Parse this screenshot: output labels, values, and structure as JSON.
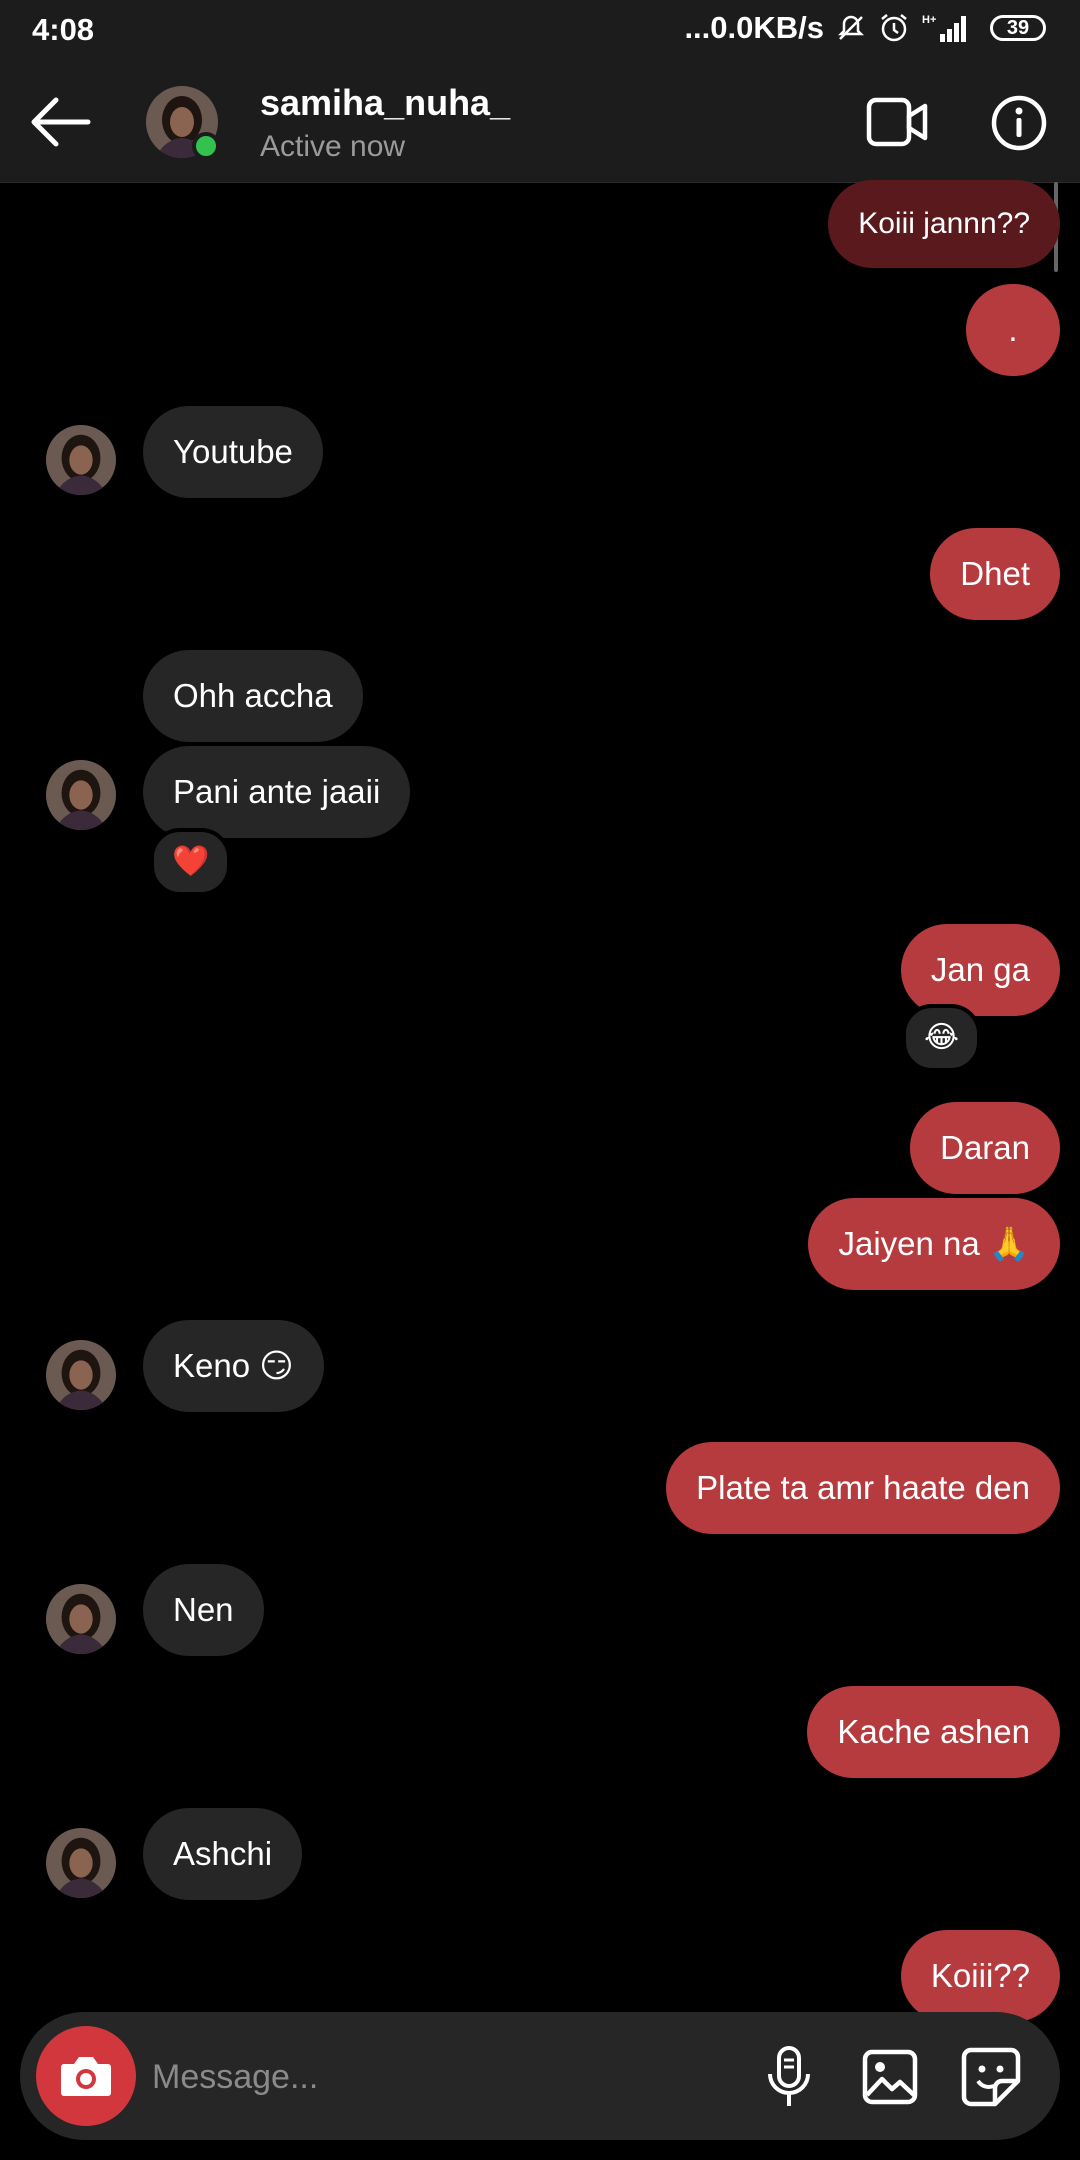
{
  "status_bar": {
    "time": "4:08",
    "network_speed": "...0.0KB/s",
    "battery": "39",
    "signal_label": "H+"
  },
  "header": {
    "username": "samiha_nuha_",
    "status": "Active now",
    "back_icon": "arrow-left-icon",
    "video_icon": "video-camera-icon",
    "info_icon": "info-icon"
  },
  "messages": [
    {
      "side": "out",
      "text": "Koiii jannn??"
    },
    {
      "side": "out",
      "text": "."
    },
    {
      "side": "in",
      "text": "Youtube"
    },
    {
      "side": "out",
      "text": "Dhet"
    },
    {
      "side": "in",
      "text": "Ohh accha"
    },
    {
      "side": "in",
      "text": "Pani ante jaaii",
      "reaction": "❤️"
    },
    {
      "side": "out",
      "text": "Jan ga",
      "reaction": "😂"
    },
    {
      "side": "out",
      "text": "Daran"
    },
    {
      "side": "out",
      "text": "Jaiyen na 🙏"
    },
    {
      "side": "in",
      "text": "Keno 😏"
    },
    {
      "side": "out",
      "text": "Plate ta amr haate den"
    },
    {
      "side": "in",
      "text": "Nen"
    },
    {
      "side": "out",
      "text": "Kache ashen"
    },
    {
      "side": "in",
      "text": "Ashchi"
    },
    {
      "side": "out",
      "text": "Koiii??"
    }
  ],
  "composer": {
    "placeholder": "Message..."
  },
  "colors": {
    "outgoing_bubble": "#b53b3f",
    "incoming_bubble": "#262626",
    "online_dot": "#32c24d",
    "camera_button": "#d1373d"
  }
}
